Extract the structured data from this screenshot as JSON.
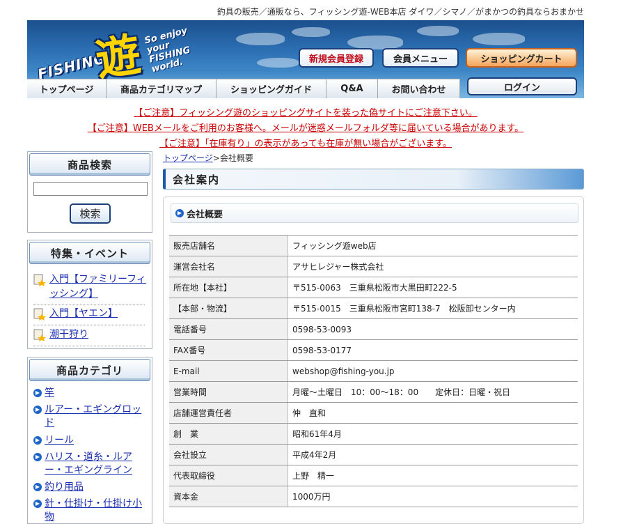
{
  "header": {
    "tagline": "釣具の販売／通販なら、フィッシング遊-WEB本店 ダイワ／シマノ／がまかつの釣具ならおまかせ",
    "logo": {
      "fishing": "FISHING",
      "kanji": "遊",
      "slogan": "So enjoy your FISHING world."
    },
    "buttons": {
      "register": "新規会員登録",
      "member_menu": "会員メニュー",
      "cart": "ショッピングカート",
      "login": "ログイン"
    },
    "nav": [
      "トップページ",
      "商品カテゴリマップ",
      "ショッピングガイド",
      "Q&A",
      "お問い合わせ"
    ]
  },
  "notices": [
    "【ご注意】フィッシング遊のショッピングサイトを装った偽サイトにご注意下さい。",
    "【ご注意】WEBメールをご利用のお客様へ。メールが迷惑メールフォルダ等に届いている場合があります。",
    "【ご注意】「在庫有り」の表示があっても在庫が無い場合がございます。"
  ],
  "sidebar": {
    "search": {
      "title": "商品検索",
      "placeholder": "",
      "button": "検索"
    },
    "events": {
      "title": "特集・イベント",
      "items": [
        "入門【ファミリーフィッシング】",
        "入門【ヤエン】",
        "潮干狩り"
      ]
    },
    "categories": {
      "title": "商品カテゴリ",
      "items": [
        "竿",
        "ルアー・エギングロッド",
        "リール",
        "ハリス・道糸・ルアー・エギングライン",
        "釣り用品",
        "針・仕掛け・仕掛け小物"
      ]
    }
  },
  "breadcrumb": {
    "home": "トップページ",
    "separator": ">",
    "current": "会社概要"
  },
  "main": {
    "title": "会社案内",
    "section": "会社概要",
    "rows": [
      {
        "label": "販売店舗名",
        "value": "フィッシング遊web店"
      },
      {
        "label": "運営会社名",
        "value": "アサヒレジャー株式会社"
      },
      {
        "label": "所在地【本社】",
        "value": "〒515-0063　三重県松阪市大黒田町222-5"
      },
      {
        "label": "【本部・物流】",
        "value": "〒515-0015　三重県松阪市宮町138-7　松阪卸センター内"
      },
      {
        "label": "電話番号",
        "value": "0598-53-0093"
      },
      {
        "label": "FAX番号",
        "value": "0598-53-0177"
      },
      {
        "label": "E-mail",
        "value": "webshop@fishing-you.jp"
      },
      {
        "label": "営業時間",
        "value": "月曜～土曜日　10：00～18：00　　定休日：日曜・祝日"
      },
      {
        "label": "店舗運営責任者",
        "value": "仲　直和"
      },
      {
        "label": "創　業",
        "value": "昭和61年4月"
      },
      {
        "label": "会社設立",
        "value": "平成4年2月"
      },
      {
        "label": "代表取締役",
        "value": "上野　精一"
      },
      {
        "label": "資本金",
        "value": "1000万円"
      }
    ]
  },
  "colors": {
    "notice": "#cc0000",
    "link": "#1a2fb0",
    "banner": "#2a6db0",
    "accent": "#1c64c8"
  }
}
